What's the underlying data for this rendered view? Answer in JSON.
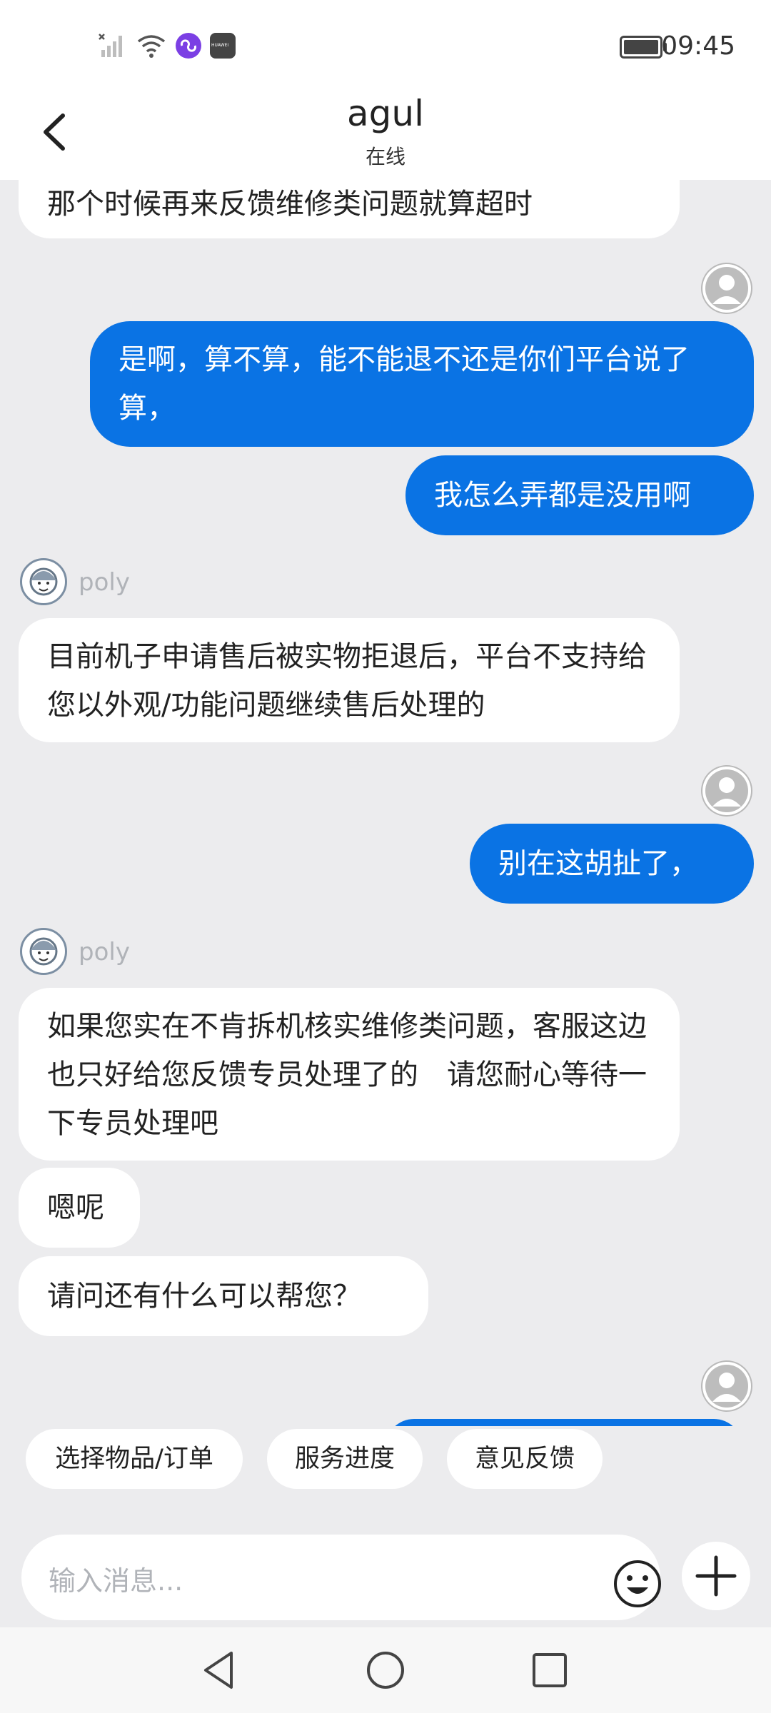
{
  "status_bar": {
    "time": "09:45",
    "icons": [
      "signal-icon",
      "wifi-icon",
      "link-app-icon",
      "huawei-app-icon"
    ],
    "battery_level": 1.0,
    "huawei_label": "HUAWEI"
  },
  "header": {
    "title": "agul",
    "subtitle": "在线"
  },
  "messages": [
    {
      "side": "in",
      "text": "那个时候再来反馈维修类问题就算超时"
    },
    {
      "side": "out",
      "text": "是啊，算不算，能不能退不还是你们平台说了算，"
    },
    {
      "side": "out",
      "text": "我怎么弄都是没用啊"
    },
    {
      "side": "in",
      "agent": "poly",
      "text": "目前机子申请售后被实物拒退后，平台不支持给您以外观/功能问题继续售后处理的"
    },
    {
      "side": "out",
      "text": "别在这胡扯了，"
    },
    {
      "side": "in",
      "agent": "poly",
      "text": "如果您实在不肯拆机核实维修类问题，客服这边也只好给您反馈专员处理了的　请您耐心等待一下专员处理吧"
    },
    {
      "side": "in",
      "text": "嗯呢"
    },
    {
      "side": "in",
      "text": "请问还有什么可以帮您？"
    }
  ],
  "agent_name": "poly",
  "quick_actions": [
    "选择物品/订单",
    "服务进度",
    "意见反馈"
  ],
  "input": {
    "placeholder": "输入消息..."
  },
  "colors": {
    "outgoing_bubble": "#0a73e4",
    "incoming_bubble": "#ffffff",
    "chat_background": "#ececee"
  }
}
